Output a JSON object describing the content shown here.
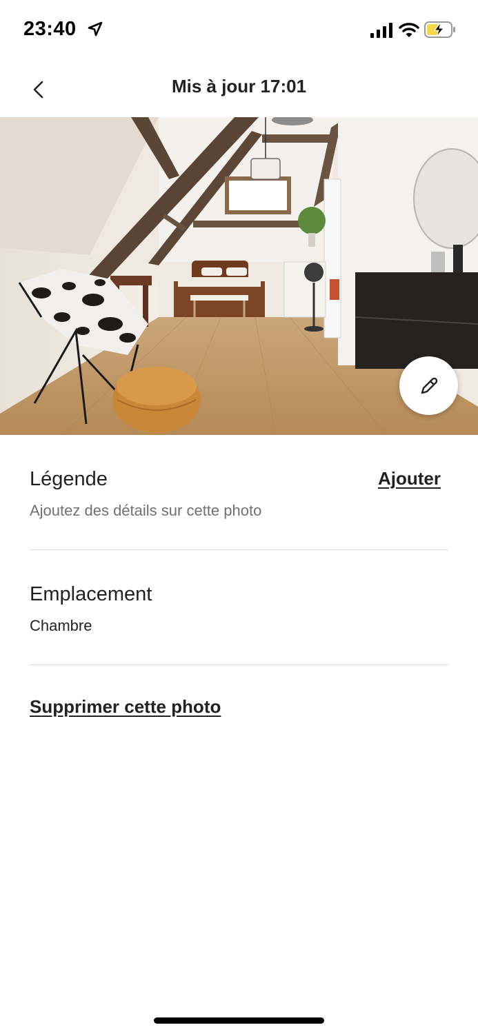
{
  "status_bar": {
    "time": "23:40",
    "icons": [
      "location-arrow-icon",
      "cellular-signal-icon",
      "wifi-icon",
      "battery-charging-icon"
    ],
    "battery_color": "#f5d94a"
  },
  "header": {
    "title": "Mis à jour 17:01",
    "back_icon": "chevron-left-icon"
  },
  "photo": {
    "subject": "attic bedroom",
    "edit_icon": "pencil-icon"
  },
  "caption": {
    "title": "Légende",
    "placeholder": "Ajoutez des détails sur cette photo",
    "action": "Ajouter"
  },
  "location": {
    "title": "Emplacement",
    "value": "Chambre"
  },
  "delete": {
    "label": "Supprimer cette photo"
  },
  "colors": {
    "text_primary": "#222222",
    "text_secondary": "#717171",
    "divider": "#dddddd"
  }
}
